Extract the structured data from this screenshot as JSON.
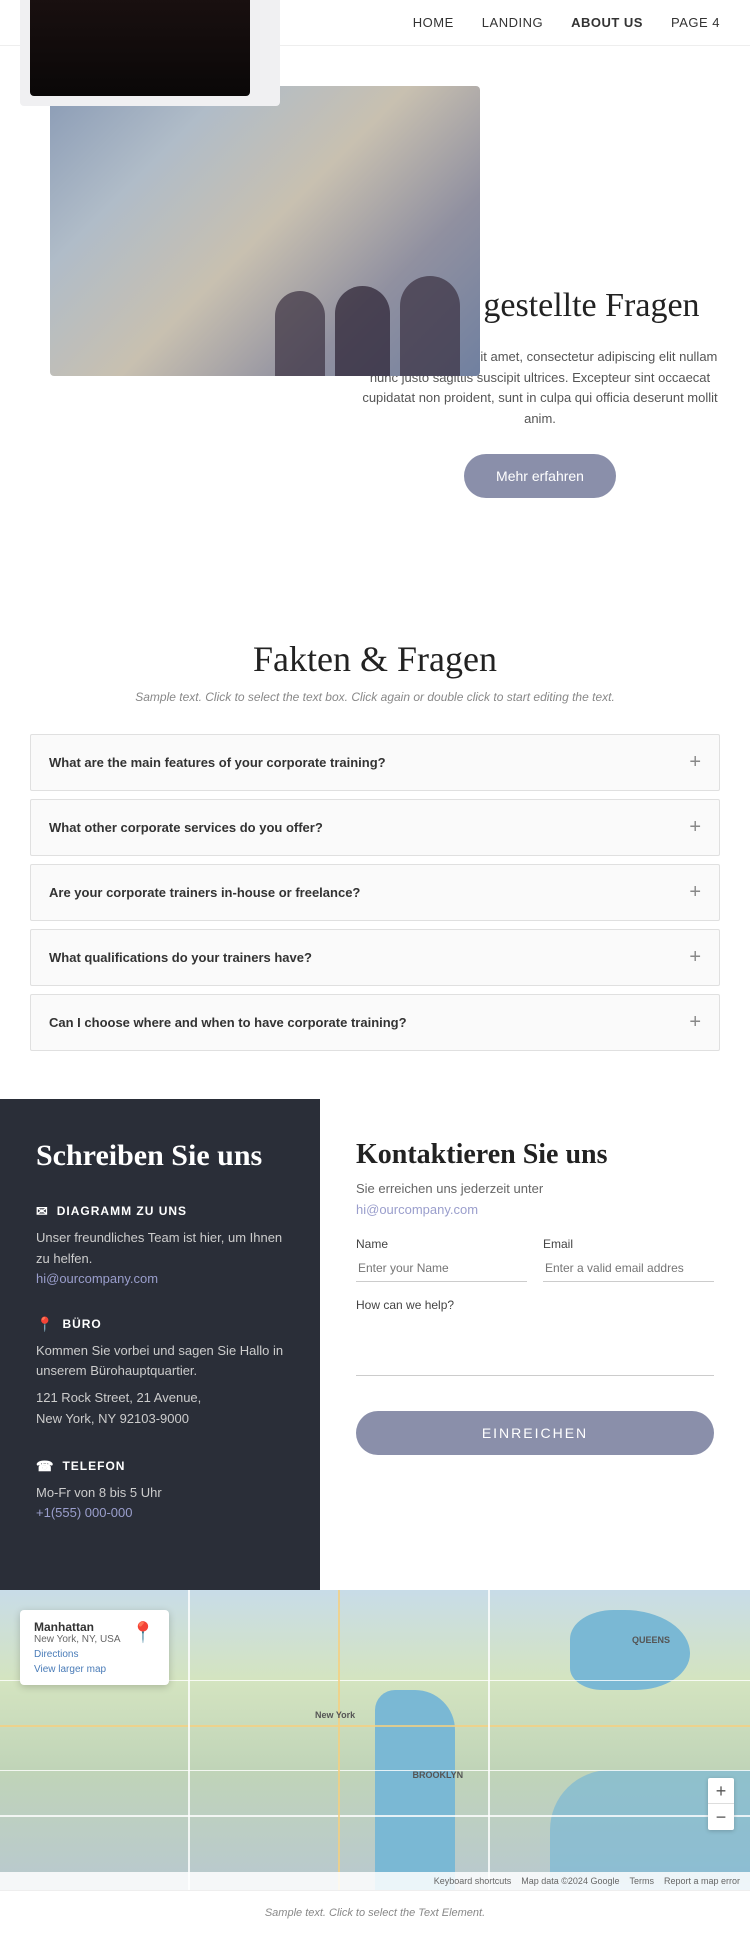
{
  "nav": {
    "logo": "logo",
    "links": [
      {
        "label": "HOME",
        "active": false
      },
      {
        "label": "LANDING",
        "active": false
      },
      {
        "label": "ABOUT US",
        "active": true
      },
      {
        "label": "PAGE 4",
        "active": false
      }
    ]
  },
  "hero": {
    "title": "Häufig gestellte Fragen",
    "description": "Lorem ipsum dolor sit amet, consectetur adipiscing elit nullam nunc justo sagittis suscipit ultrices. Excepteur sint occaecat cupidatat non proident, sunt in culpa qui officia deserunt mollit anim.",
    "button_label": "Mehr erfahren"
  },
  "faq_section": {
    "title": "Fakten & Fragen",
    "subtitle": "Sample text. Click to select the text box. Click again or double click to start editing the text.",
    "items": [
      {
        "question": "What are the main features of your corporate training?"
      },
      {
        "question": "What other corporate services do you offer?"
      },
      {
        "question": "Are your corporate trainers in-house or freelance?"
      },
      {
        "question": "What qualifications do your trainers have?"
      },
      {
        "question": "Can I choose where and when to have corporate training?"
      }
    ]
  },
  "contact": {
    "left_title": "Schreiben Sie uns",
    "email_label": "DIAGRAMM ZU UNS",
    "email_desc": "Unser freundliches Team ist hier, um Ihnen zu helfen.",
    "email_link": "hi@ourcompany.com",
    "office_label": "BÜRO",
    "office_desc": "Kommen Sie vorbei und sagen Sie Hallo in unserem Bürohauptquartier.",
    "office_address": "121 Rock Street, 21 Avenue,\nNew York, NY 92103-9000",
    "phone_label": "TELEFON",
    "phone_hours": "Mo-Fr von 8 bis 5 Uhr",
    "phone_number": "+1(555) 000-000",
    "right_title": "Kontaktieren Sie uns",
    "right_subtitle": "Sie erreichen uns jederzeit unter",
    "right_email": "hi@ourcompany.com",
    "name_label": "Name",
    "name_placeholder": "Enter your Name",
    "email_field_label": "Email",
    "email_field_placeholder": "Enter a valid email addres",
    "help_label": "How can we help?",
    "submit_label": "EINREICHEN"
  },
  "map": {
    "location": "Manhattan",
    "location_sub": "New York, NY, USA",
    "directions": "Directions",
    "view_map": "View larger map",
    "zoom_in": "+",
    "zoom_out": "−",
    "footer_items": [
      "Keyboard shortcuts",
      "Map data ©2024 Google",
      "Terms",
      "Report a map error"
    ]
  },
  "footer": {
    "text": "Sample text. Click to select the Text Element."
  }
}
